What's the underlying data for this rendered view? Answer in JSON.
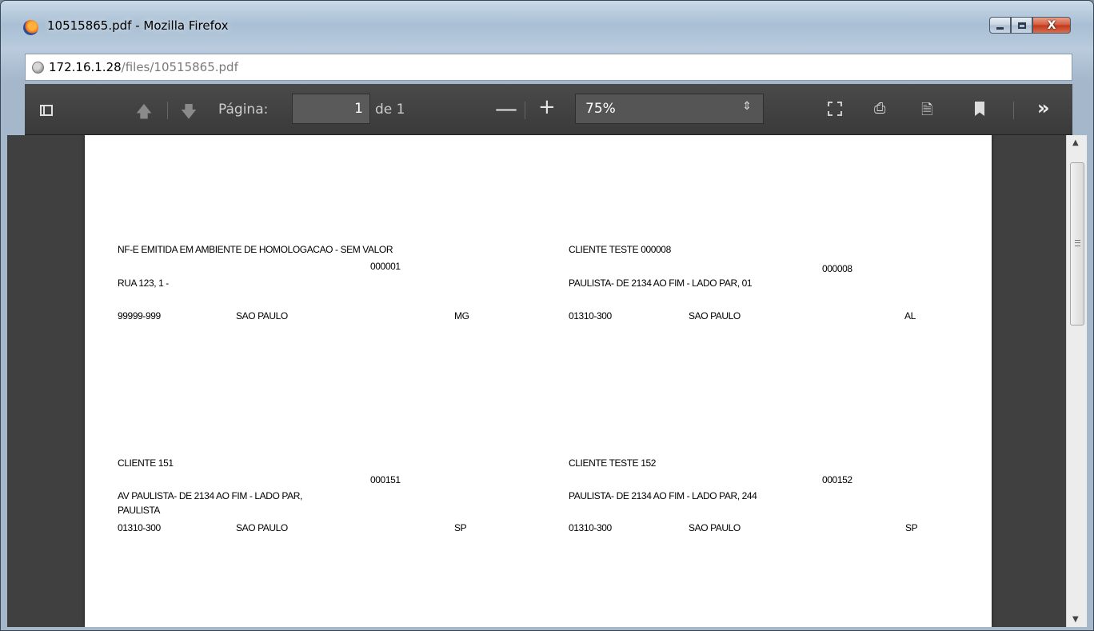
{
  "window": {
    "title": "10515865.pdf - Mozilla Firefox",
    "close_label": "X"
  },
  "urlbar": {
    "host": "172.16.1.28",
    "path": "/files/10515865.pdf"
  },
  "toolbar": {
    "page_label": "Página:",
    "page_value": "1",
    "page_of": "de 1",
    "zoom_out_label": "—",
    "zoom_in_label": "+",
    "zoom_value": "75%",
    "zoom_arrow": "⇕",
    "more_label": "»"
  },
  "document": {
    "labels": [
      {
        "l1": "NF-E EMITIDA EM AMBIENTE DE HOMOLOGACAO - SEM VALOR",
        "code": "000001",
        "l2": "RUA 123, 1 -",
        "l3": "",
        "cep": "99999-999",
        "city": "SAO PAULO",
        "uf": "MG"
      },
      {
        "l1": "CLIENTE TESTE 000008",
        "code": "000008",
        "l2": "PAULISTA- DE 2134 AO FIM - LADO PAR, 01",
        "l3": "",
        "cep": "01310-300",
        "city": "SAO PAULO",
        "uf": "AL"
      },
      {
        "l1": "CLIENTE 151",
        "code": "000151",
        "l2": "AV PAULISTA- DE 2134 AO FIM - LADO PAR,",
        "l3": "PAULISTA",
        "cep": "01310-300",
        "city": "SAO PAULO",
        "uf": "SP"
      },
      {
        "l1": "CLIENTE TESTE 152",
        "code": "000152",
        "l2": "PAULISTA- DE 2134 AO FIM - LADO PAR, 244",
        "l3": "",
        "cep": "01310-300",
        "city": "SAO PAULO",
        "uf": "SP"
      }
    ]
  },
  "colors": {
    "toolbar_bg": "#3a3a3a",
    "viewer_bg": "#404040",
    "page_bg": "#ffffff",
    "close_button": "#c0381a"
  },
  "icons": {
    "sidebar": "sidebar-toggle-icon",
    "prev_page": "arrow-up-icon",
    "next_page": "arrow-down-icon",
    "fullscreen": "fullscreen-icon",
    "print": "print-icon",
    "download": "download-icon",
    "bookmark": "bookmark-icon",
    "more": "double-chevron-right-icon"
  }
}
